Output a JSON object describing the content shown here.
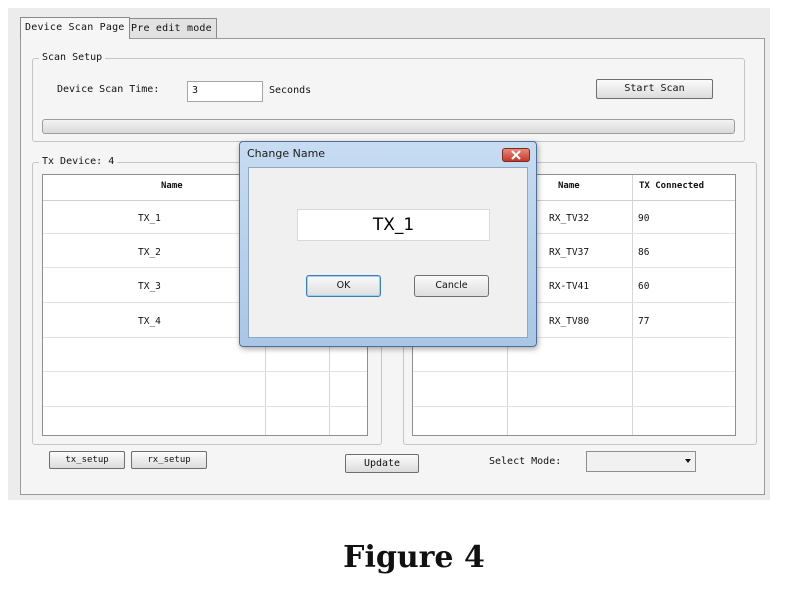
{
  "tabs": [
    {
      "label": "Device Scan Page",
      "active": true
    },
    {
      "label": "Pre edit mode",
      "active": false
    }
  ],
  "scan_setup": {
    "title": "Scan Setup",
    "time_label": "Device Scan Time:",
    "time_value": "3",
    "unit_label": "Seconds",
    "start_button": "Start Scan"
  },
  "tx_panel": {
    "title": "Tx Device: 4",
    "column_name": "Name",
    "rows": [
      "TX_1",
      "TX_2",
      "TX_3",
      "TX_4"
    ]
  },
  "rx_panel": {
    "column_name": "Name",
    "column_connected": "TX Connected",
    "rows": [
      {
        "name": "RX_TV32",
        "connected": "90"
      },
      {
        "name": "RX_TV37",
        "connected": "86"
      },
      {
        "name": "RX-TV41",
        "connected": "60"
      },
      {
        "name": "RX_TV80",
        "connected": "77"
      }
    ]
  },
  "bottom": {
    "tx_setup": "tx_setup",
    "rx_setup": "rx_setup",
    "update": "Update",
    "select_mode_label": "Select Mode:",
    "select_mode_value": ""
  },
  "dialog": {
    "title": "Change Name",
    "name_value": "TX_1",
    "ok": "OK",
    "cancel": "Cancle"
  },
  "caption": "Figure  4",
  "colors": {
    "dialog_frame": "#a9c6e6",
    "close_button": "#c2392a",
    "default_button_focus": "#3c7fb1"
  }
}
